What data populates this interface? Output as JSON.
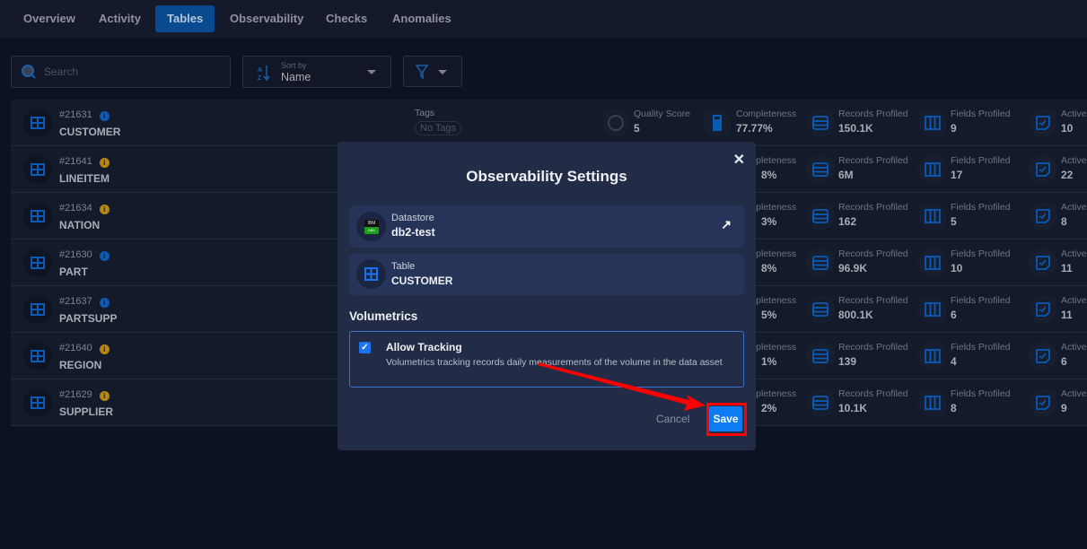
{
  "tabs": [
    {
      "label": "Overview",
      "active": false
    },
    {
      "label": "Activity",
      "active": false
    },
    {
      "label": "Tables",
      "active": true
    },
    {
      "label": "Observability",
      "active": false
    },
    {
      "label": "Checks",
      "active": false
    },
    {
      "label": "Anomalies",
      "active": false
    }
  ],
  "toolbar": {
    "search_placeholder": "Search",
    "sort_label": "Sort by",
    "sort_value": "Name"
  },
  "tags_label": "Tags",
  "no_tags": "No Tags",
  "stat_labels": {
    "quality": "Quality Score",
    "completeness": "Completeness",
    "records": "Records Profiled",
    "fields": "Fields Profiled",
    "active": "Active"
  },
  "rows": [
    {
      "id": "#21631",
      "name": "CUSTOMER",
      "info": "blue",
      "quality": "5",
      "completeness": "77.77%",
      "records": "150.1K",
      "fields": "9",
      "active": "10"
    },
    {
      "id": "#21641",
      "name": "LINEITEM",
      "info": "orange",
      "completeness": "8%",
      "records": "6M",
      "fields": "17",
      "active": "22"
    },
    {
      "id": "#21634",
      "name": "NATION",
      "info": "orange",
      "completeness": "3%",
      "records": "162",
      "fields": "5",
      "active": "8"
    },
    {
      "id": "#21630",
      "name": "PART",
      "info": "blue",
      "completeness": "8%",
      "records": "96.9K",
      "fields": "10",
      "active": "11"
    },
    {
      "id": "#21637",
      "name": "PARTSUPP",
      "info": "blue",
      "completeness": "5%",
      "records": "800.1K",
      "fields": "6",
      "active": "11"
    },
    {
      "id": "#21640",
      "name": "REGION",
      "info": "orange",
      "completeness": "1%",
      "records": "139",
      "fields": "4",
      "active": "6"
    },
    {
      "id": "#21629",
      "name": "SUPPLIER",
      "info": "orange",
      "completeness": "2%",
      "records": "10.1K",
      "fields": "8",
      "active": "9"
    }
  ],
  "colors": {
    "blue": "#0a5bb5",
    "orange": "#b8860b",
    "accent": "#0d7cf2",
    "annotation": "#ff0000"
  },
  "modal": {
    "title": "Observability Settings",
    "datastore_label": "Datastore",
    "datastore_value": "db2-test",
    "datastore_logo": "IBM DB2",
    "table_label": "Table",
    "table_value": "CUSTOMER",
    "section": "Volumetrics",
    "allow_tracking": "Allow Tracking",
    "allow_tracking_checked": true,
    "description": "Volumetrics tracking records daily measurements of the volume in the data asset",
    "cancel": "Cancel",
    "save": "Save"
  }
}
